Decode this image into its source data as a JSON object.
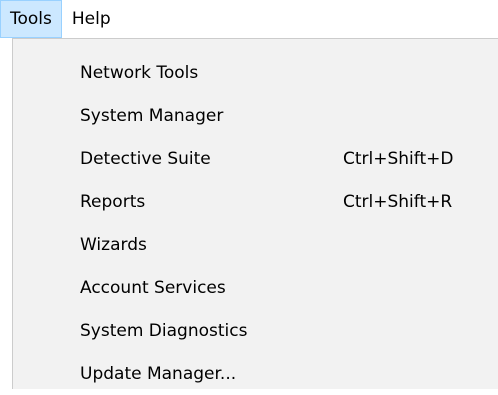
{
  "menubar": {
    "items": [
      {
        "label": "Tools"
      },
      {
        "label": "Help"
      }
    ]
  },
  "tools_menu": {
    "items": [
      {
        "label": "Network Tools",
        "shortcut": ""
      },
      {
        "label": "System Manager",
        "shortcut": ""
      },
      {
        "label": "Detective Suite",
        "shortcut": "Ctrl+Shift+D"
      },
      {
        "label": "Reports",
        "shortcut": "Ctrl+Shift+R"
      },
      {
        "label": "Wizards",
        "shortcut": ""
      },
      {
        "label": "Account Services",
        "shortcut": ""
      },
      {
        "label": "System Diagnostics",
        "shortcut": ""
      },
      {
        "label": "Update Manager...",
        "shortcut": ""
      }
    ]
  },
  "colors": {
    "active_menubar_bg": "#cce8ff",
    "active_menubar_border": "#99d1ff",
    "dropdown_bg": "#f2f2f2"
  }
}
